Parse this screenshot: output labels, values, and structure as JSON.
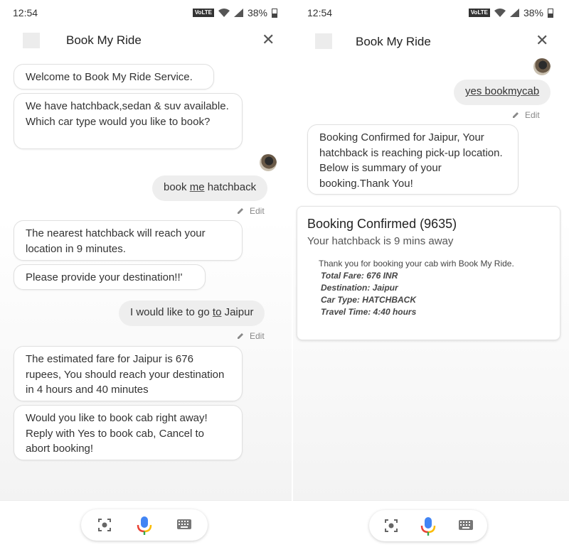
{
  "status": {
    "time": "12:54",
    "volte": "VoLTE",
    "battery": "38%"
  },
  "header": {
    "title": "Book My Ride"
  },
  "screen1": {
    "bot1": "Welcome to Book My Ride Service.",
    "bot2": "We have hatchback,sedan & suv available. Which car type would you like to book?",
    "user1": {
      "a": "book ",
      "u": "me",
      "b": " hatchback"
    },
    "edit": "Edit",
    "bot3": "The nearest hatchback will reach your location in 9 minutes.",
    "bot4": "Please provide your destination!!'",
    "user2": {
      "a": "I would like to go ",
      "u": "to",
      "b": " Jaipur"
    },
    "bot5": "The estimated fare for Jaipur is 676 rupees, You should reach your destination in 4 hours and 40 minutes",
    "bot6": "Would you like to book cab right away! Reply with Yes to book cab, Cancel to abort booking!"
  },
  "screen2": {
    "user1": "yes bookmycab",
    "edit": "Edit",
    "bot1": "Booking Confirmed for Jaipur, Your hatchback is reaching pick-up location. Below is summary of your booking.Thank You!",
    "card": {
      "title": "Booking Confirmed (9635)",
      "subtitle": "Your hatchback is 9 mins away",
      "intro": "Thank you for booking your cab wirh Book My Ride.",
      "fare": "Total Fare: 676 INR",
      "destination": "Destination: Jaipur",
      "car_type": "Car Type: HATCHBACK",
      "travel_time": "Travel Time: 4:40 hours"
    }
  },
  "icons": [
    "lens-icon",
    "mic-icon",
    "keyboard-icon"
  ],
  "colors": {
    "mic_blue": "#4285F4",
    "mic_red": "#EA4335",
    "mic_yellow": "#FBBC05",
    "mic_green": "#34A853"
  }
}
